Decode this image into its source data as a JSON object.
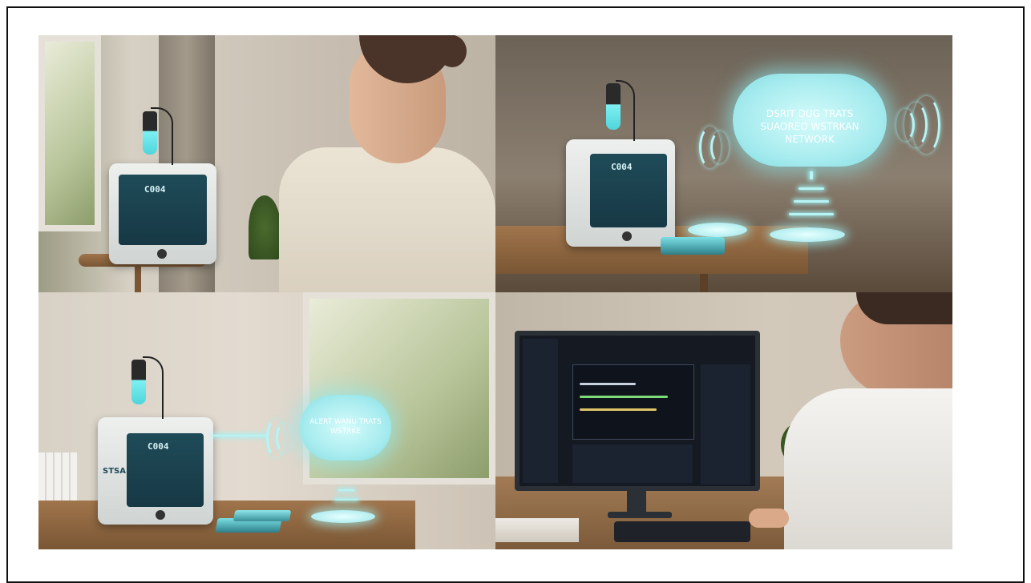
{
  "panels": [
    {
      "name": "woman-with-monitoring-device",
      "device_screen": "C004"
    },
    {
      "name": "device-with-cloud-network",
      "device_screen": "C004",
      "cloud_lines": [
        "DSRIT DUG TRATS",
        "SUAOREO WSTRKAN",
        "NETWORK"
      ]
    },
    {
      "name": "device-with-alert-cloud",
      "device_screen": "C004",
      "device_side": "STSA",
      "cloud_lines": [
        "ALERT WANU TRATS",
        "WSTRKE"
      ]
    },
    {
      "name": "man-at-computer-dashboard"
    }
  ],
  "colors": {
    "frame_border": "#111111",
    "glow": "#b7f4f6",
    "screen": "#1f4b58"
  }
}
